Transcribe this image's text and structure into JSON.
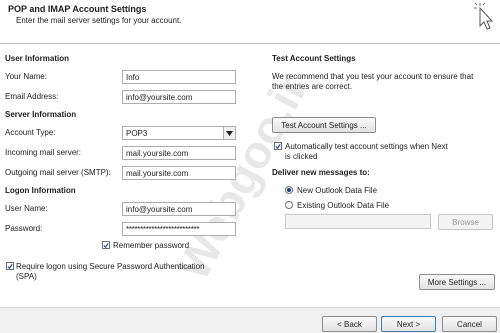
{
  "header": {
    "title": "POP and IMAP Account Settings",
    "subtitle": "Enter the mail server settings for your account."
  },
  "user_info": {
    "heading": "User Information",
    "your_name_label": "Your Name:",
    "your_name_value": "Info",
    "email_label": "Email Address:",
    "email_value": "info@yoursite.com"
  },
  "server_info": {
    "heading": "Server Information",
    "account_type_label": "Account Type:",
    "account_type_value": "POP3",
    "incoming_label": "Incoming mail server:",
    "incoming_value": "mail.yoursite.com",
    "outgoing_label": "Outgoing mail server (SMTP):",
    "outgoing_value": "mail.yoursite.com"
  },
  "logon_info": {
    "heading": "Logon Information",
    "username_label": "User Name:",
    "username_value": "info@yoursite.com",
    "password_label": "Password:",
    "password_value": "**************************",
    "remember_label": "Remember password",
    "spa_label_line1": "Require logon using Secure Password Authentication",
    "spa_label_line2": "(SPA)"
  },
  "test_settings": {
    "heading": "Test Account Settings",
    "desc_line1": "We recommend that you test your account to ensure that",
    "desc_line2": "the entries are correct.",
    "test_button": "Test Account Settings ...",
    "auto_test_line1": "Automatically test account settings when Next",
    "auto_test_line2": "is clicked"
  },
  "delivery": {
    "heading": "Deliver new messages to:",
    "option_new": "New Outlook Data File",
    "option_existing": "Existing Outlook Data File",
    "browse_button": "Browse"
  },
  "more_settings_button": "More Settings ...",
  "footer": {
    "back_button": "< Back",
    "next_button": "Next >",
    "cancel_button": "Cancel"
  },
  "watermark_text": "Webgoo.ir"
}
